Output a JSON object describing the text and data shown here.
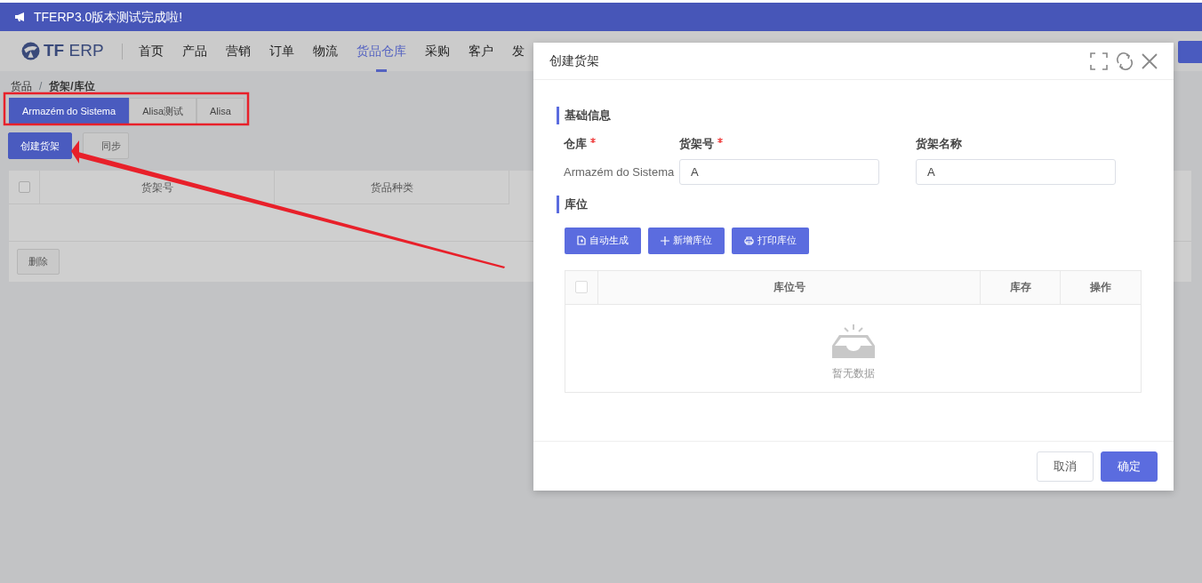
{
  "announcement": {
    "text": "TFERP3.0版本测试完成啦!"
  },
  "logo": {
    "text": "**TF** ERP"
  },
  "nav": [
    {
      "label": "首页",
      "selected": false
    },
    {
      "label": "产品",
      "selected": false
    },
    {
      "label": "营销",
      "selected": false
    },
    {
      "label": "订单",
      "selected": false
    },
    {
      "label": "物流",
      "selected": false
    },
    {
      "label": "货品仓库",
      "selected": true
    },
    {
      "label": "采购",
      "selected": false
    },
    {
      "label": "客户",
      "selected": false
    },
    {
      "label": "发",
      "selected": false
    }
  ],
  "breadcrumb": {
    "items": [
      "货品",
      "货架/库位"
    ],
    "separator": "/"
  },
  "warehouse_tabs": [
    {
      "label": "Armazém do Sistema",
      "selected": true
    },
    {
      "label": "Alisa测试",
      "selected": false
    },
    {
      "label": "Alisa",
      "selected": false
    }
  ],
  "actions": [
    {
      "label": "创建货架",
      "kind": "primary"
    },
    {
      "label": "同步",
      "kind": "default"
    }
  ],
  "table": {
    "select_all_checked": false,
    "columns": [
      "货架号",
      "货品种类"
    ],
    "footer_button": "删除"
  },
  "dialog": {
    "title": "创建货架",
    "sections": [
      {
        "title": "基础信息",
        "fields": [
          {
            "label": "仓库",
            "required": true,
            "kind": "static",
            "value": "Armazém do Sistema"
          },
          {
            "label": "货架号",
            "required": true,
            "kind": "input",
            "value": "A"
          },
          {
            "label": "货架名称",
            "required": false,
            "kind": "input",
            "value": "A"
          }
        ]
      },
      {
        "title": "库位",
        "buttons": [
          {
            "label": "自动生成",
            "kind": "generate"
          },
          {
            "label": "新增库位",
            "kind": "add"
          },
          {
            "label": "打印库位",
            "kind": "print"
          }
        ],
        "table": {
          "select_all_checked": false,
          "columns": [
            "库位号",
            "库存",
            "操作"
          ],
          "empty_text": "暂无数据"
        }
      }
    ],
    "footer": [
      {
        "label": "取消",
        "kind": "default"
      },
      {
        "label": "确定",
        "kind": "primary"
      }
    ]
  }
}
